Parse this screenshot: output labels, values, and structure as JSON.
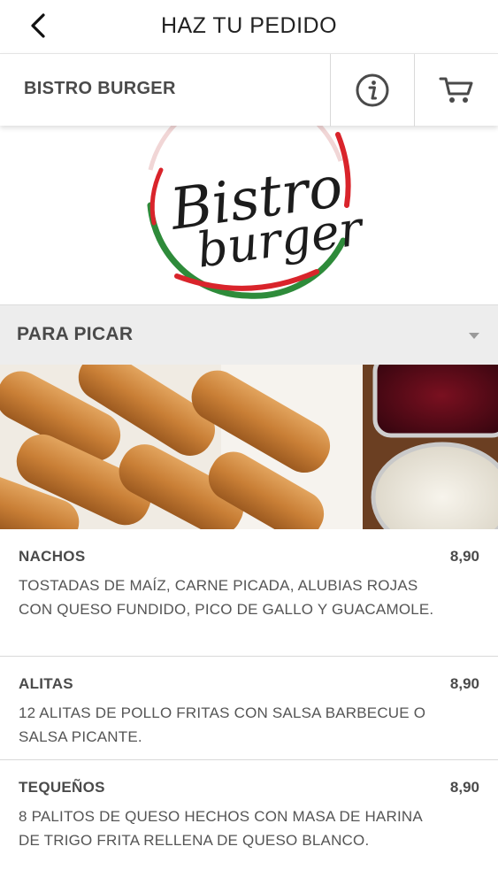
{
  "header": {
    "title": "HAZ TU PEDIDO",
    "back_icon": "chevron-left-icon"
  },
  "restaurant": {
    "name": "BISTRO BURGER",
    "info_icon": "info-icon",
    "cart_icon": "cart-icon"
  },
  "logo": {
    "line1": "Bistro",
    "line2": "burger"
  },
  "category": {
    "label": "PARA PICAR",
    "icon": "caret-down-icon"
  },
  "items": [
    {
      "name": "NACHOS",
      "price": "8,90",
      "description": "TOSTADAS DE MAÍZ, CARNE PICADA, ALUBIAS ROJAS CON QUESO FUNDIDO, PICO DE GALLO Y GUACAMOLE."
    },
    {
      "name": "ALITAS",
      "price": "8,90",
      "description": "12 ALITAS DE POLLO FRITAS CON SALSA BARBECUE O SALSA PICANTE."
    },
    {
      "name": "TEQUEÑOS",
      "price": "8,90",
      "description": "8 PALITOS DE QUESO HECHOS CON MASA DE HARINA DE TRIGO FRITA RELLENA DE QUESO BLANCO."
    }
  ],
  "colors": {
    "logo_green": "#2e8b3a",
    "logo_red": "#d9242b",
    "text_dark": "#4a4a4a",
    "category_bg": "#ededed"
  }
}
